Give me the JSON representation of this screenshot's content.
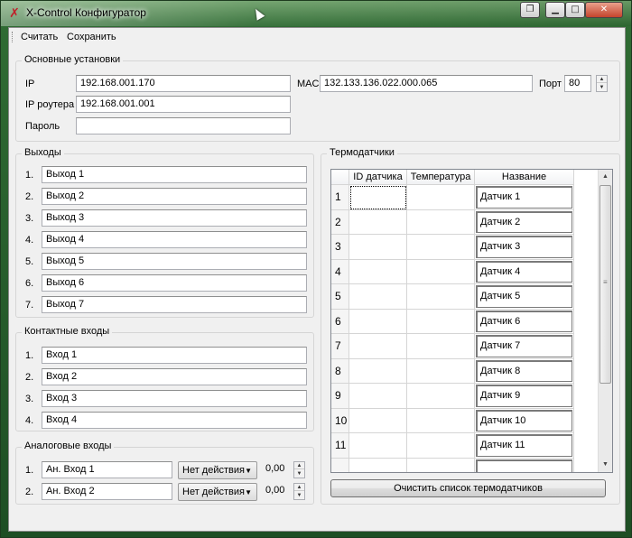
{
  "window": {
    "title": "X-Control Конфигуратор",
    "app_icon_glyph": "✗"
  },
  "menu": {
    "items": [
      "Считать",
      "Сохранить"
    ]
  },
  "basic": {
    "title": "Основные установки",
    "ip_label": "IP",
    "ip_value": "192.168.001.170",
    "mac_label": "MAC",
    "mac_value": "132.133.136.022.000.065",
    "port_label": "Порт",
    "port_value": "80",
    "router_label": "IP роутера",
    "router_value": "192.168.001.001",
    "password_label": "Пароль",
    "password_value": ""
  },
  "outputs": {
    "title": "Выходы",
    "items": [
      {
        "num": "1.",
        "value": "Выход 1"
      },
      {
        "num": "2.",
        "value": "Выход 2"
      },
      {
        "num": "3.",
        "value": "Выход 3"
      },
      {
        "num": "4.",
        "value": "Выход 4"
      },
      {
        "num": "5.",
        "value": "Выход 5"
      },
      {
        "num": "6.",
        "value": "Выход 6"
      },
      {
        "num": "7.",
        "value": "Выход 7"
      }
    ]
  },
  "contact_inputs": {
    "title": "Контактные входы",
    "items": [
      {
        "num": "1.",
        "value": "Вход 1"
      },
      {
        "num": "2.",
        "value": "Вход 2"
      },
      {
        "num": "3.",
        "value": "Вход 3"
      },
      {
        "num": "4.",
        "value": "Вход 4"
      }
    ]
  },
  "analog_inputs": {
    "title": "Аналоговые входы",
    "items": [
      {
        "num": "1.",
        "value": "Ан. Вход 1",
        "action": "Нет действия",
        "number": "0,00"
      },
      {
        "num": "2.",
        "value": "Ан. Вход 2",
        "action": "Нет действия",
        "number": "0,00"
      }
    ]
  },
  "sensors": {
    "title": "Термодатчики",
    "columns": [
      "ID датчика",
      "Температура",
      "Название"
    ],
    "rows": [
      {
        "num": "1",
        "id": "",
        "temp": "",
        "name": "Датчик 1"
      },
      {
        "num": "2",
        "id": "",
        "temp": "",
        "name": "Датчик 2"
      },
      {
        "num": "3",
        "id": "",
        "temp": "",
        "name": "Датчик 3"
      },
      {
        "num": "4",
        "id": "",
        "temp": "",
        "name": "Датчик 4"
      },
      {
        "num": "5",
        "id": "",
        "temp": "",
        "name": "Датчик 5"
      },
      {
        "num": "6",
        "id": "",
        "temp": "",
        "name": "Датчик 6"
      },
      {
        "num": "7",
        "id": "",
        "temp": "",
        "name": "Датчик 7"
      },
      {
        "num": "8",
        "id": "",
        "temp": "",
        "name": "Датчик 8"
      },
      {
        "num": "9",
        "id": "",
        "temp": "",
        "name": "Датчик 9"
      },
      {
        "num": "10",
        "id": "",
        "temp": "",
        "name": "Датчик 10"
      },
      {
        "num": "11",
        "id": "",
        "temp": "",
        "name": "Датчик 11"
      },
      {
        "num": "",
        "id": "",
        "temp": "",
        "name": ""
      }
    ],
    "clear_button": "Очистить список термодатчиков"
  }
}
